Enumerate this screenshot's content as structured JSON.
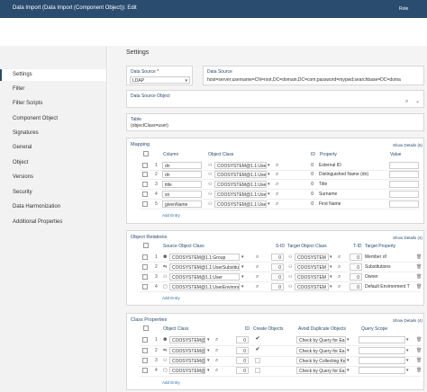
{
  "header": {
    "title": "Data Import (Data Import (Component Object)): Edit",
    "role": "Role"
  },
  "sidebar": {
    "items": [
      {
        "label": "Settings"
      },
      {
        "label": "Filter"
      },
      {
        "label": "Filter Scripts"
      },
      {
        "label": "Component Object"
      },
      {
        "label": "Signatures"
      },
      {
        "label": "General"
      },
      {
        "label": "Object"
      },
      {
        "label": "Versions"
      },
      {
        "label": "Security"
      },
      {
        "label": "Data Harmonization"
      },
      {
        "label": "Additional Properties"
      }
    ]
  },
  "main": {
    "heading": "Settings",
    "data_source_type": {
      "label": "Data Source",
      "required": "*",
      "value": "LDAP"
    },
    "data_source": {
      "label": "Data Source",
      "value": "host=server;username=CN=root,DC=domain,DC=com;password=mypwd;searchbase=DC=doma"
    },
    "data_source_object": {
      "label": "Data Source Object"
    },
    "table": {
      "label": "Table",
      "value": "(objectClass=user)"
    },
    "mapping": {
      "title": "Mapping",
      "show_details": "Show Details (5)",
      "columns": {
        "column": "Column",
        "object_class": "Object Class",
        "id": "ID",
        "property": "Property",
        "value": "Value"
      },
      "rows": [
        {
          "column": "dn",
          "object_class": "COOSYSTEM@1.1:Use",
          "id": "0",
          "property": "External ID"
        },
        {
          "column": "dn",
          "object_class": "COOSYSTEM@1.1:Use",
          "id": "0",
          "property": "Distinguished Name (dn)"
        },
        {
          "column": "title",
          "object_class": "COOSYSTEM@1.1:Use",
          "id": "0",
          "property": "Title"
        },
        {
          "column": "sn",
          "object_class": "COOSYSTEM@1.1:Use",
          "id": "0",
          "property": "Surname"
        },
        {
          "column": "givenName",
          "object_class": "COOSYSTEM@1.1:Use",
          "id": "0",
          "property": "First Name"
        }
      ],
      "add_entry": "Add Entry"
    },
    "object_relations": {
      "title": "Object Relations",
      "show_details": "Show Details (4)",
      "columns": {
        "source": "Source Object Class",
        "sid": "S-ID",
        "target": "Target Object Class",
        "tid": "T-ID",
        "property": "Target Property"
      },
      "rows": [
        {
          "source": "COOSYSTEM@1.1:Group",
          "sid": "0",
          "target": "COOSYSTEM",
          "tid": "0",
          "property": "Member of"
        },
        {
          "source": "COOSYSTEM@1.1:UserSubstitution",
          "sid": "0",
          "target": "COOSYSTEM",
          "tid": "0",
          "property": "Substitutions"
        },
        {
          "source": "COOSYSTEM@1.1:User",
          "sid": "0",
          "target": "COOSYSTEM",
          "tid": "0",
          "property": "Owner"
        },
        {
          "source": "COOSYSTEM@1.1:UserEnvironment",
          "sid": "0",
          "target": "COOSYSTEM",
          "tid": "0",
          "property": "Default Environment T"
        }
      ],
      "add_entry": "Add Entry"
    },
    "class_properties": {
      "title": "Class Properties",
      "show_details": "Show Details (4)",
      "columns": {
        "object_class": "Object Class",
        "id": "ID",
        "create": "Create Objects",
        "avoid": "Avoid Duplicate Objects",
        "scope": "Query Scope"
      },
      "rows": [
        {
          "object_class": "COOSYSTEM@",
          "id": "0",
          "create": "✔",
          "avoid": "Check by Query for Ea"
        },
        {
          "object_class": "COOSYSTEM@",
          "id": "0",
          "create": "✔",
          "avoid": "Check by Query for Ea"
        },
        {
          "object_class": "COOSYSTEM@",
          "id": "0",
          "create": "",
          "avoid": "Check by Collecting Ke"
        },
        {
          "object_class": "COOSYSTEM@",
          "id": "0",
          "create": "",
          "avoid": "Check by Query for Ea"
        }
      ],
      "add_entry": "Add Entry"
    }
  },
  "colors": {
    "header_bg": "#2a4c6e",
    "accent": "#2a6ea6"
  }
}
